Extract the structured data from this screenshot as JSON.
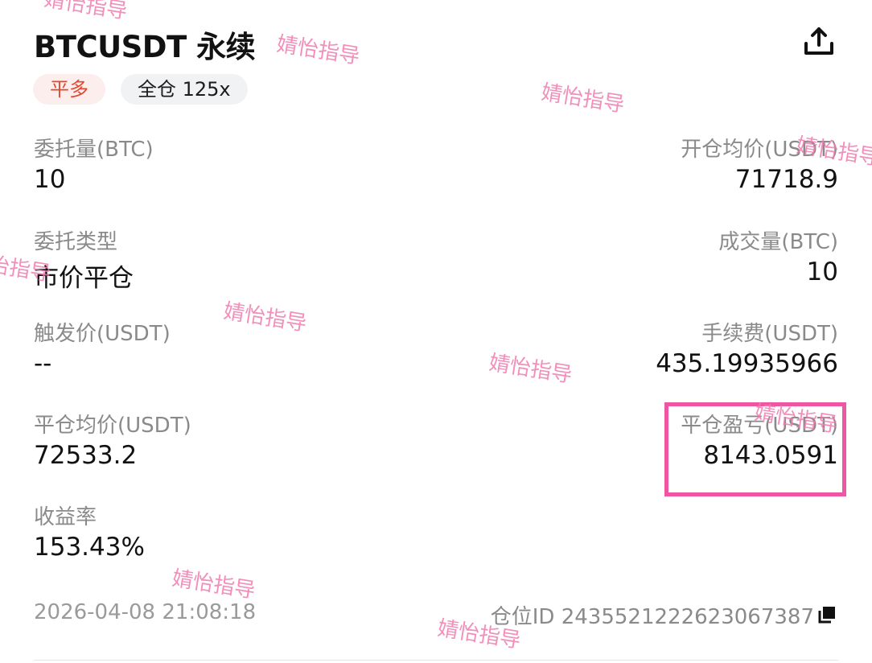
{
  "header": {
    "title": "BTCUSDT 永续",
    "share_icon": "share-icon"
  },
  "badges": {
    "side": "平多",
    "margin": "全仓 125x"
  },
  "fields": {
    "order_qty_label": "委托量(BTC)",
    "order_qty_value": "10",
    "open_avg_label": "开仓均价(USDT)",
    "open_avg_value": "71718.9",
    "order_type_label": "委托类型",
    "order_type_value": "市价平仓",
    "filled_qty_label": "成交量(BTC)",
    "filled_qty_value": "10",
    "trigger_label": "触发价(USDT)",
    "trigger_value": "--",
    "fee_label": "手续费(USDT)",
    "fee_value": "435.19935966",
    "close_avg_label": "平仓均价(USDT)",
    "close_avg_value": "72533.2",
    "pnl_label": "平仓盈亏(USDT)",
    "pnl_value": "8143.0591",
    "roi_label": "收益率",
    "roi_value": "153.43%"
  },
  "footer": {
    "timestamp": "2026-04-08 21:08:18",
    "position_id": "仓位ID 2435521222623067387",
    "copy_icon": "copy-icon"
  },
  "watermark": "婧怡指导",
  "colors": {
    "highlight": "#ee56a3",
    "close_badge_text": "#e0492f",
    "close_badge_bg": "#fdeeee",
    "watermark": "#f07cb0"
  }
}
